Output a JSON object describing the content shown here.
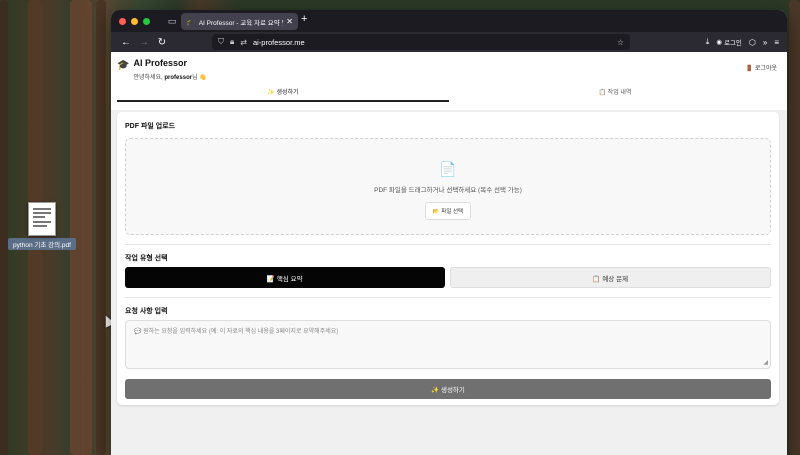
{
  "desktop": {
    "file_label": "python 기초 강의.pdf"
  },
  "browser": {
    "tab_title": "AI Professor - 교육 자료 요약 및 문제",
    "url": "ai-professor.me",
    "login_label": "로그인",
    "traffic_colors": [
      "#ff5f57",
      "#febc2e",
      "#28c840"
    ]
  },
  "app": {
    "brand_title": "AI Professor",
    "greeting_prefix": "안녕하세요, ",
    "greeting_user": "professor",
    "greeting_suffix": "님 👋",
    "logout_label": "🚪 로그아웃",
    "tabs": [
      {
        "label": "✨ 생성하기",
        "active": true
      },
      {
        "label": "📋 작업 내역",
        "active": false
      }
    ],
    "upload": {
      "heading": "PDF 파일 업로드",
      "dropzone_text": "PDF 파일을 드래그하거나 선택하세요 (복수 선택 가능)",
      "select_button": "📂 파일 선택"
    },
    "task_type": {
      "heading": "작업 유형 선택",
      "options": [
        {
          "label": "📝 핵심 요약",
          "selected": true
        },
        {
          "label": "📋 예상 문제",
          "selected": false
        }
      ]
    },
    "request": {
      "heading": "요청 사항 입력",
      "placeholder": "💬 원하는 요청을 입력하세요 (예: 이 자료의 핵심 내용을 3페이지로 요약해주세요)"
    },
    "generate_button": "✨ 생성하기"
  }
}
